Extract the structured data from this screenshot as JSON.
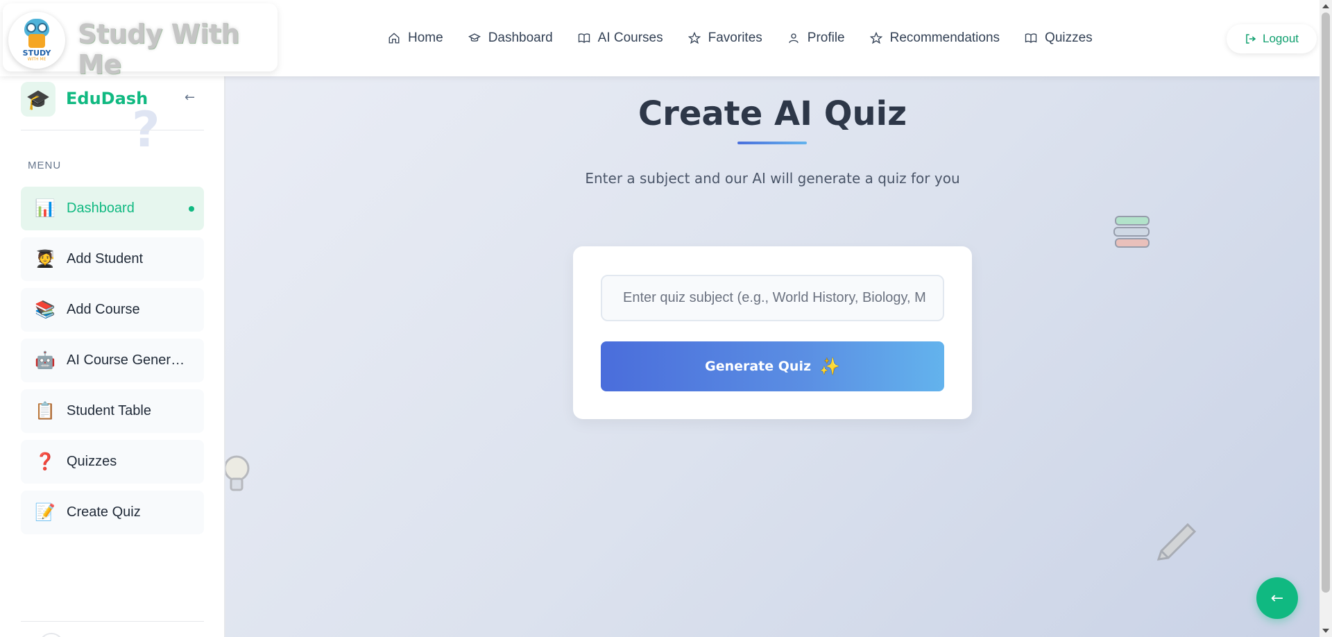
{
  "brand": {
    "logo_text": "STUDY",
    "logo_sub": "WITH ME",
    "title": "Study With Me"
  },
  "nav": {
    "items": [
      {
        "label": "Home",
        "icon": "home-icon"
      },
      {
        "label": "Dashboard",
        "icon": "graduation-cap-icon"
      },
      {
        "label": "AI Courses",
        "icon": "book-open-icon"
      },
      {
        "label": "Favorites",
        "icon": "star-icon"
      },
      {
        "label": "Profile",
        "icon": "user-icon"
      },
      {
        "label": "Recommendations",
        "icon": "star-icon"
      },
      {
        "label": "Quizzes",
        "icon": "book-open-icon"
      }
    ],
    "logout_label": "Logout"
  },
  "sidebar": {
    "title": "EduDash",
    "collapse_glyph": "←",
    "menu_label": "MENU",
    "items": [
      {
        "label": "Dashboard",
        "icon": "📊",
        "active": true
      },
      {
        "label": "Add Student",
        "icon": "🧑‍🎓",
        "active": false
      },
      {
        "label": "Add Course",
        "icon": "📚",
        "active": false
      },
      {
        "label": "AI Course Genera...",
        "icon": "🤖",
        "active": false
      },
      {
        "label": "Student Table",
        "icon": "📋",
        "active": false
      },
      {
        "label": "Quizzes",
        "icon": "❓",
        "active": false
      },
      {
        "label": "Create Quiz",
        "icon": "📝",
        "active": false
      }
    ]
  },
  "main": {
    "title": "Create AI Quiz",
    "subtitle": "Enter a subject and our AI will generate a quiz for you",
    "input": {
      "value": "",
      "placeholder": "Enter quiz subject (e.g., World History, Biology, M"
    },
    "generate_label": "Generate Quiz",
    "generate_icon": "✨",
    "back_glyph": "←"
  },
  "colors": {
    "accent_green": "#10b981",
    "button_blue_start": "#4a6ddb",
    "button_blue_end": "#63b3ed",
    "title_text": "#2d3748"
  }
}
